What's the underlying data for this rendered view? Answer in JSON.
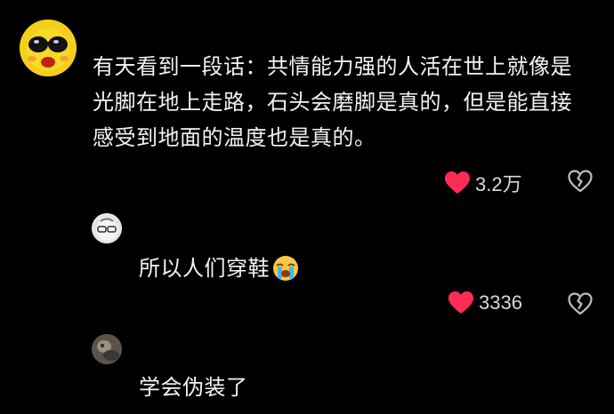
{
  "comments": [
    {
      "text": "有天看到一段话：共情能力强的人活在世上就像是光脚在地上走路，石头会磨脚是真的，但是能直接感受到地面的温度也是真的。",
      "likes": "3.2万",
      "avatar_icon": "sunglasses-face-icon"
    },
    {
      "text": "所以人们穿鞋",
      "emoji": "crying-face-emoji",
      "likes": "3336",
      "avatar_icon": "cartoon-face-icon"
    },
    {
      "text": "学会伪装了",
      "avatar_icon": "dark-portrait-icon"
    }
  ],
  "colors": {
    "background": "#000000",
    "like_heart": "#ff2d55",
    "text": "#f4f4f4",
    "count": "#d9d9d9"
  }
}
